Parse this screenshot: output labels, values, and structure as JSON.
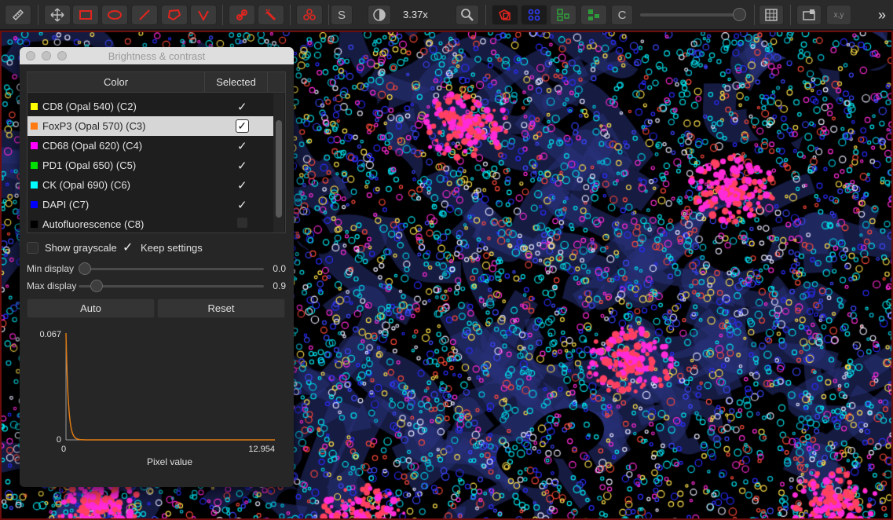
{
  "toolbar": {
    "zoom": "3.37x",
    "s_label": "S",
    "c_label": "C",
    "xy_label": "x,y",
    "colors": {
      "draw_red": "#e0261f",
      "overlay_blue": "#2c3cff",
      "overlay_green": "#2f9a3a"
    }
  },
  "dialog": {
    "title": "Brightness & contrast",
    "columns": {
      "color": "Color",
      "selected": "Selected"
    },
    "channels": [
      {
        "name": "CD8 (Opal 540) (C2)",
        "color": "#ffff00",
        "selected": true,
        "highlighted": false
      },
      {
        "name": "FoxP3 (Opal 570) (C3)",
        "color": "#ff7a12",
        "selected": true,
        "highlighted": true
      },
      {
        "name": "CD68 (Opal 620) (C4)",
        "color": "#ff00ff",
        "selected": true,
        "highlighted": false
      },
      {
        "name": "PD1 (Opal 650) (C5)",
        "color": "#00e000",
        "selected": true,
        "highlighted": false
      },
      {
        "name": "CK (Opal 690) (C6)",
        "color": "#00ffff",
        "selected": true,
        "highlighted": false
      },
      {
        "name": "DAPI (C7)",
        "color": "#0000ff",
        "selected": true,
        "highlighted": false
      },
      {
        "name": "Autofluorescence (C8)",
        "color": "#000000",
        "selected": false,
        "highlighted": false
      }
    ],
    "show_grayscale": {
      "label": "Show grayscale",
      "checked": false
    },
    "keep_settings": {
      "label": "Keep settings",
      "checked": true
    },
    "min_display": {
      "label": "Min display",
      "value": "0.0"
    },
    "max_display": {
      "label": "Max display",
      "value": "0.9"
    },
    "auto_label": "Auto",
    "reset_label": "Reset",
    "histogram": {
      "y_max_label": "0.067",
      "y_min_label": "0",
      "x_min_label": "0",
      "x_max_label": "12.954",
      "xlabel": "Pixel value",
      "line_color": "#e07b12"
    }
  }
}
